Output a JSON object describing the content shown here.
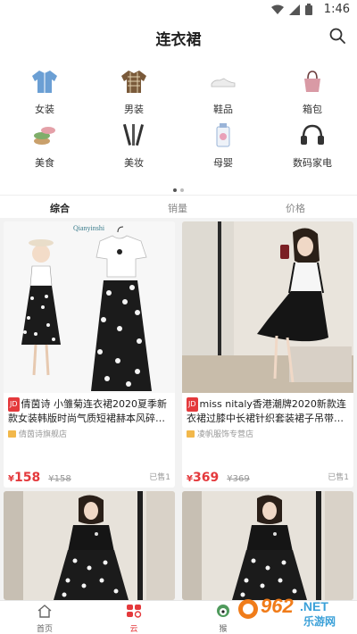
{
  "status": {
    "time": "1:46"
  },
  "header": {
    "title": "连衣裙",
    "search_icon": "search-icon"
  },
  "categories": [
    {
      "label": "女装",
      "icon": "jacket-icon",
      "color": "#6b9fd4"
    },
    {
      "label": "男装",
      "icon": "shirt-icon",
      "color": "#7a5a3a"
    },
    {
      "label": "鞋品",
      "icon": "shoe-icon",
      "color": "#dddddd"
    },
    {
      "label": "箱包",
      "icon": "handbag-icon",
      "color": "#d99aa5"
    },
    {
      "label": "美食",
      "icon": "macaron-icon",
      "color": "#c9a06b"
    },
    {
      "label": "美妆",
      "icon": "makeup-brush-icon",
      "color": "#333333"
    },
    {
      "label": "母婴",
      "icon": "baby-bottle-icon",
      "color": "#9ab4d8"
    },
    {
      "label": "数码家电",
      "icon": "headphones-icon",
      "color": "#333333"
    }
  ],
  "pager": {
    "count": 2,
    "active": 0
  },
  "sort": {
    "items": [
      "综合",
      "销量",
      "价格"
    ],
    "active": 0
  },
  "products": [
    {
      "brand_label": "JD",
      "title": "倩茵诗 小雏菊连衣裙2020夏季新款女装韩版时尚气质短裙赫本风碎…",
      "shop": "倩茵诗旗舰店",
      "price_symbol": "¥",
      "price": "158",
      "old_price": "¥158",
      "sold": "已售1",
      "image_watermark": "Qianyinshi"
    },
    {
      "brand_label": "JD",
      "title": "miss nitaly香港潮牌2020新款连衣裙过膝中长裙针织套装裙子吊带…",
      "shop": "凌帆服饰专营店",
      "price_symbol": "¥",
      "price": "369",
      "old_price": "¥369",
      "sold": "已售1"
    },
    {
      "title": "",
      "image": "black-top-floral-skirt-photo"
    },
    {
      "title": "",
      "image": "black-top-floral-skirt-photo"
    }
  ],
  "tabbar": {
    "items": [
      {
        "label": "首页",
        "icon": "home-icon"
      },
      {
        "label": "云",
        "icon": "cloud-grid-icon"
      },
      {
        "label": "猴",
        "icon": "monkey-icon"
      }
    ],
    "active": 1
  },
  "watermark": {
    "text": "962",
    "suffix": ".NET",
    "sub": "乐游网"
  },
  "colors": {
    "accent": "#e4393c",
    "background": "#f2f2f2"
  }
}
